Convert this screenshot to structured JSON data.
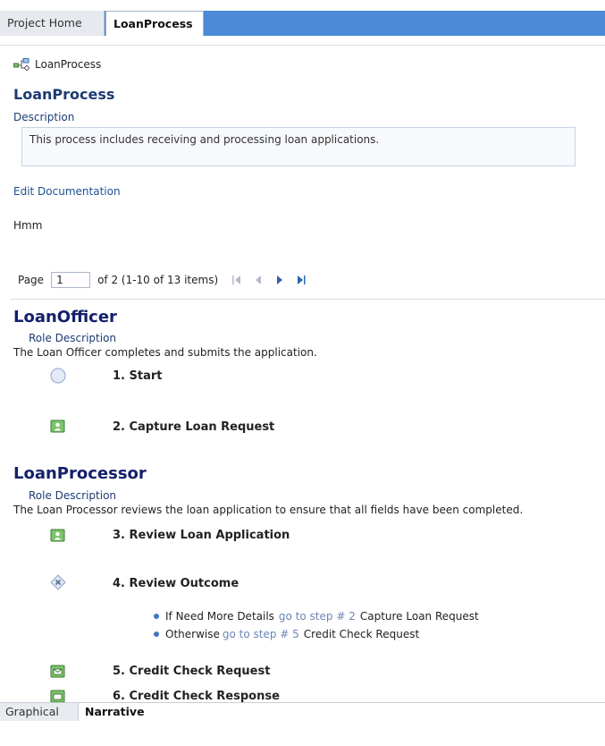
{
  "tabs": [
    {
      "label": "Project Home"
    },
    {
      "label": "LoanProcess"
    }
  ],
  "breadcrumb": {
    "label": "LoanProcess",
    "icon": "process-icon"
  },
  "process": {
    "title": "LoanProcess",
    "description_label": "Description",
    "description": "This process includes receiving and processing loan applications.",
    "edit_link": "Edit Documentation",
    "note": "Hmm"
  },
  "pager": {
    "page_label": "Page",
    "page_value": "1",
    "summary": "of 2 (1-10 of 13 items)"
  },
  "roles": [
    {
      "name": "LoanOfficer",
      "desc_label": "Role Description",
      "desc": "The Loan Officer completes and submits the application."
    },
    {
      "name": "LoanProcessor",
      "desc_label": "Role Description",
      "desc": "The Loan Processor reviews the loan application to ensure that all fields have been completed."
    }
  ],
  "steps": [
    {
      "label": "1. Start",
      "icon": "start-event-icon"
    },
    {
      "label": "2. Capture Loan Request",
      "icon": "user-task-icon"
    },
    {
      "label": "3. Review Loan Application",
      "icon": "user-task-icon"
    },
    {
      "label": "4. Review Outcome",
      "icon": "gateway-icon"
    },
    {
      "label": "5. Credit Check Request",
      "icon": "send-task-icon"
    },
    {
      "label": "6. Credit Check Response",
      "icon": "receive-task-icon"
    }
  ],
  "branches": [
    {
      "condition": "If Need More Details",
      "goto": "go to step # 2",
      "target": "Capture Loan Request"
    },
    {
      "condition": "Otherwise",
      "goto": "go to step # 5",
      "target": "Credit Check Request"
    }
  ],
  "bottom_tabs": [
    {
      "label": "Graphical"
    },
    {
      "label": "Narrative"
    }
  ],
  "colors": {
    "tab_bar": "#4a8ad6",
    "heading": "#14206b",
    "link": "#1d4f91",
    "goto": "#6b87b5"
  }
}
